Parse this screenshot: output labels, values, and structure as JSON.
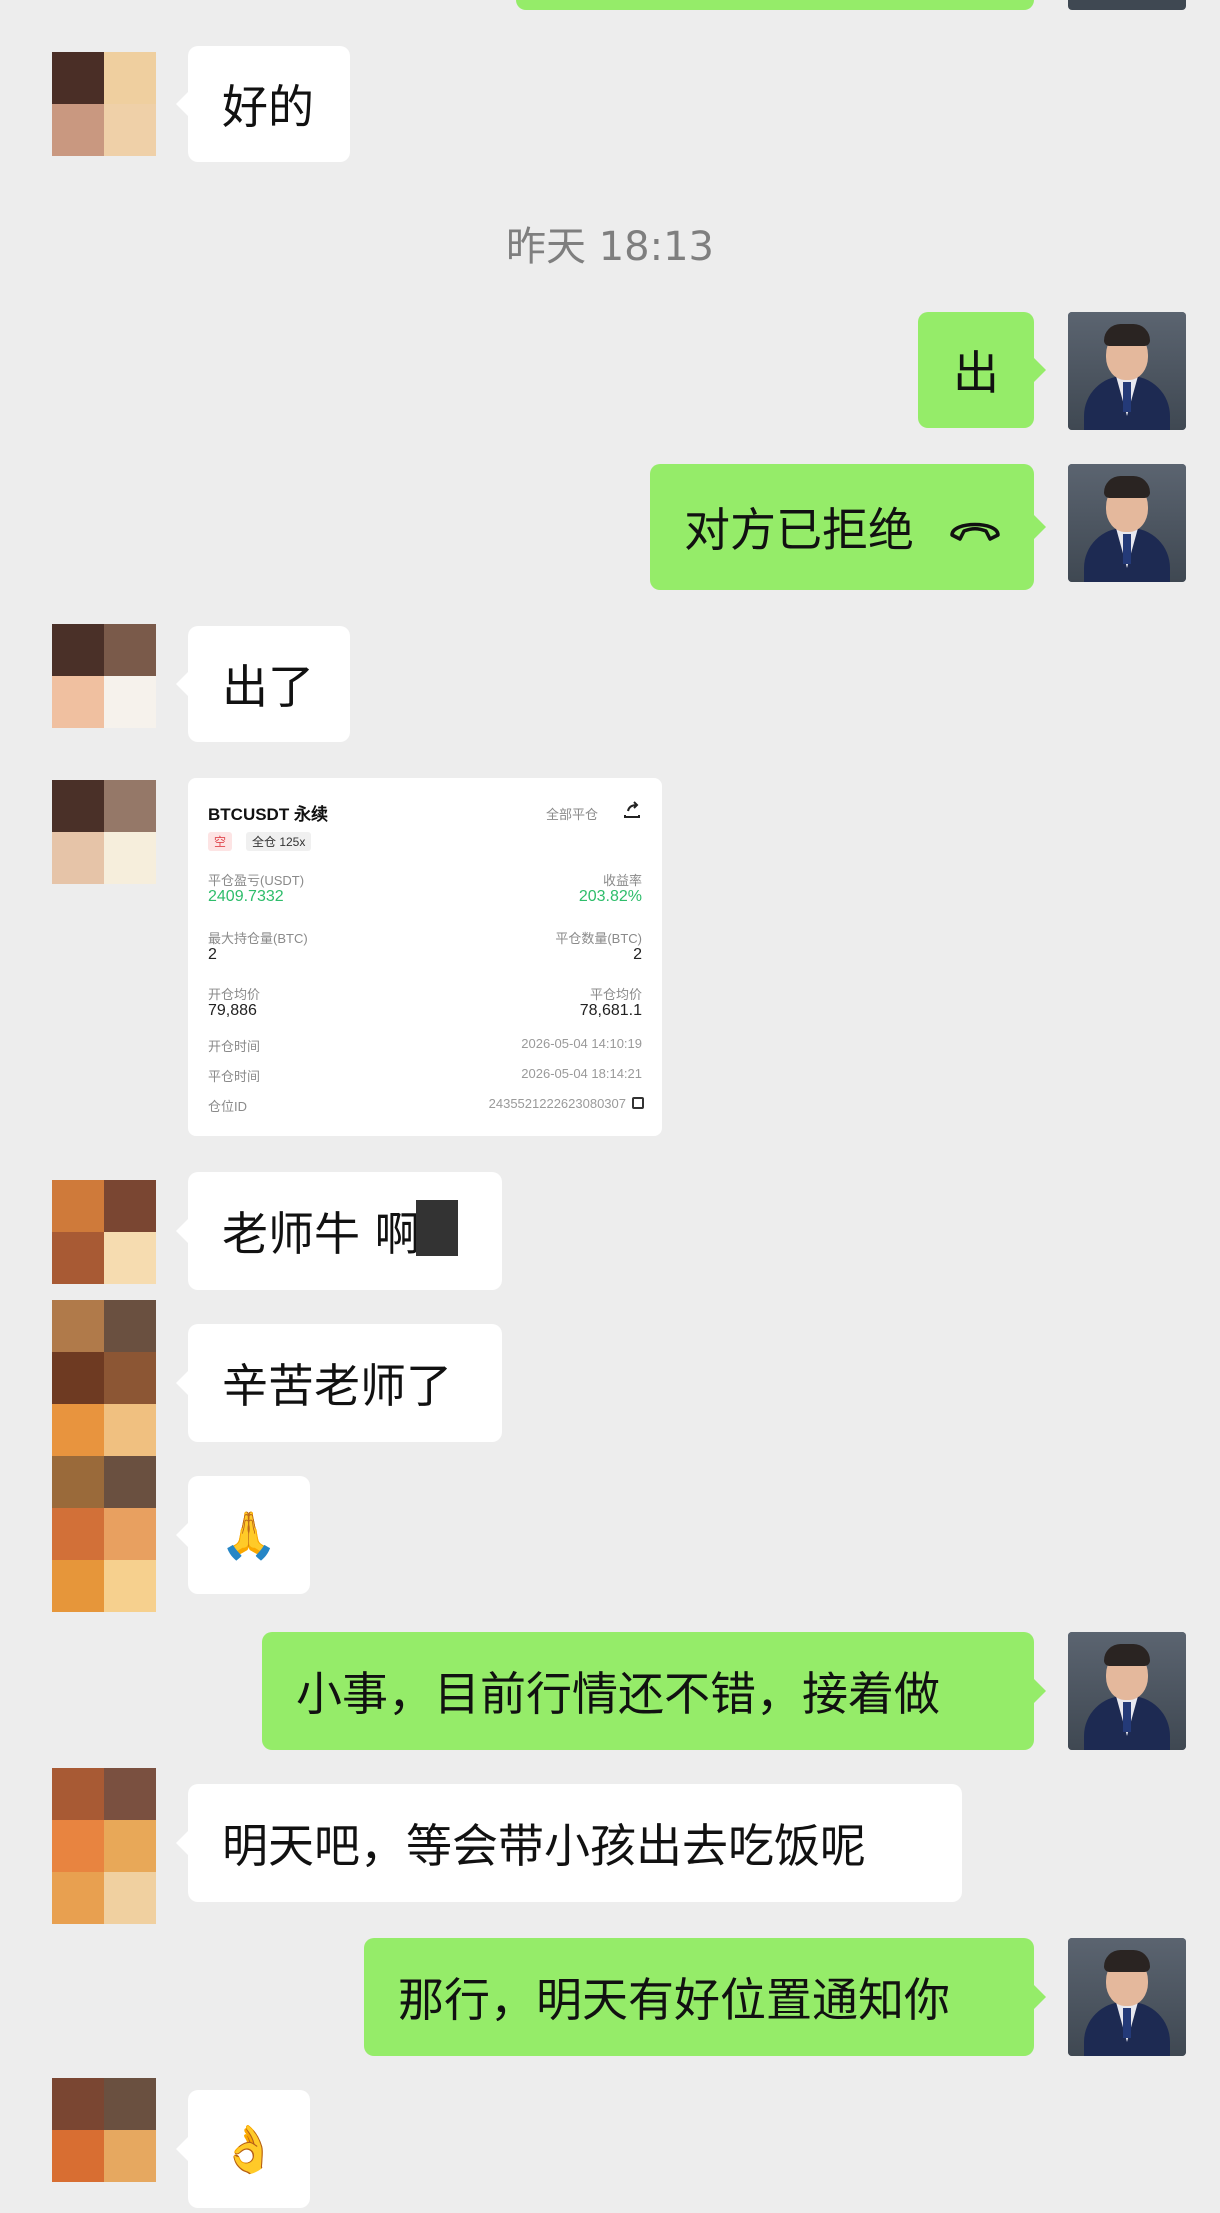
{
  "colors": {
    "background": "#ededed",
    "bubble_out": "#95ec69",
    "bubble_in": "#ffffff",
    "profit_green": "#2ebd6b"
  },
  "messages": {
    "m1": "好的",
    "timestamp": "昨天 18:13",
    "m2": "出",
    "m3": "对方已拒绝",
    "m3_icon": "phone-hangup-icon",
    "m4": "出了",
    "m6": "老师牛  啊",
    "m7": "辛苦老师了",
    "m8": "🙏",
    "m9": "小事，目前行情还不错，接着做",
    "m10": "明天吧，等会带小孩出去吃饭呢",
    "m11": "那行，明天有好位置通知你",
    "m12": "👌"
  },
  "trade_card": {
    "symbol": "BTCUSDT 永续",
    "close_all": "全部平仓",
    "side_tag": "空",
    "margin_tag": "全仓 125x",
    "pnl_label": "平仓盈亏(USDT)",
    "pnl_value": "2409.7332",
    "roi_label": "收益率",
    "roi_value": "203.82%",
    "max_pos_label": "最大持仓量(BTC)",
    "max_pos_value": "2",
    "close_qty_label": "平仓数量(BTC)",
    "close_qty_value": "2",
    "open_avg_label": "开仓均价",
    "open_avg_value": "79,886",
    "close_avg_label": "平仓均价",
    "close_avg_value": "78,681.1",
    "open_time_label": "开仓时间",
    "open_time_value": "2026-05-04 14:10:19",
    "close_time_label": "平仓时间",
    "close_time_value": "2026-05-04 18:14:21",
    "position_id_label": "仓位ID",
    "position_id_value": "2435521222623080307"
  }
}
